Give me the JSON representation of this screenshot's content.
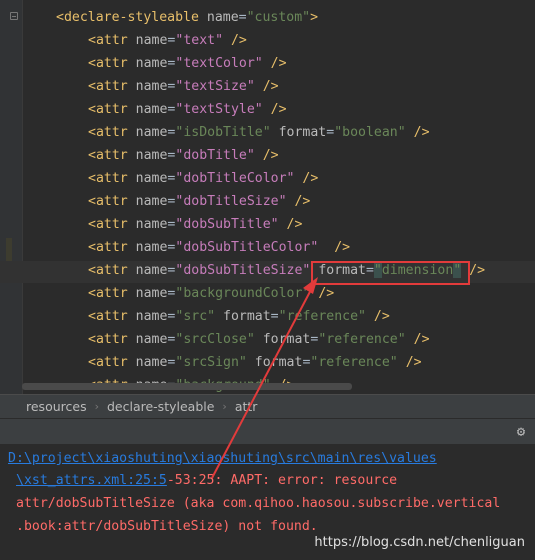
{
  "editor": {
    "lines": [
      {
        "indent": "",
        "tag": "<declare-styleable",
        "attr": "name",
        "value": "\"custom\"",
        "close": ">"
      },
      {
        "indent": "    ",
        "tag": "<attr",
        "attr": "name",
        "value": "\"text\"",
        "close": "/>"
      },
      {
        "indent": "    ",
        "tag": "<attr",
        "attr": "name",
        "value": "\"textColor\"",
        "close": "/>"
      },
      {
        "indent": "    ",
        "tag": "<attr",
        "attr": "name",
        "value": "\"textSize\"",
        "close": "/>"
      },
      {
        "indent": "    ",
        "tag": "<attr",
        "attr": "name",
        "value": "\"textStyle\"",
        "close": "/>"
      },
      {
        "indent": "    ",
        "tag": "<attr",
        "attr": "name",
        "value": "\"isDobTitle\"",
        "format": "\"boolean\"",
        "close": "/>"
      },
      {
        "indent": "    ",
        "tag": "<attr",
        "attr": "name",
        "value": "\"dobTitle\"",
        "close": "/>"
      },
      {
        "indent": "    ",
        "tag": "<attr",
        "attr": "name",
        "value": "\"dobTitleColor\"",
        "close": "/>"
      },
      {
        "indent": "    ",
        "tag": "<attr",
        "attr": "name",
        "value": "\"dobTitleSize\"",
        "close": "/>"
      },
      {
        "indent": "    ",
        "tag": "<attr",
        "attr": "name",
        "value": "\"dobSubTitle\"",
        "close": "/>"
      },
      {
        "indent": "    ",
        "tag": "<attr",
        "attr": "name",
        "value": "\"dobSubTitleColor\"",
        "close": " />"
      },
      {
        "indent": "    ",
        "tag": "<attr",
        "attr": "name",
        "value": "\"dobSubTitleSize\"",
        "format": "dimension",
        "close": "/>"
      },
      {
        "indent": "    ",
        "tag": "<attr",
        "attr": "name",
        "value": "\"backgroundColor\"",
        "close": "/>"
      },
      {
        "indent": "    ",
        "tag": "<attr",
        "attr": "name",
        "value": "\"src\"",
        "format": "\"reference\"",
        "close": "/>"
      },
      {
        "indent": "    ",
        "tag": "<attr",
        "attr": "name",
        "value": "\"srcClose\"",
        "format": "\"reference\"",
        "close": "/>"
      },
      {
        "indent": "    ",
        "tag": "<attr",
        "attr": "name",
        "value": "\"srcSign\"",
        "format": "\"reference\"",
        "close": "/>"
      },
      {
        "indent": "    ",
        "tag": "<attr",
        "attr": "name",
        "value": "\"background\"",
        "close": "/>"
      }
    ],
    "format_keyword": "format",
    "eq": "="
  },
  "breadcrumb": {
    "items": [
      "resources",
      "declare-styleable",
      "attr"
    ]
  },
  "console": {
    "path_link": "D:\\project\\xiaoshuting\\xiaoshuting\\src\\main\\res\\values",
    "file_link": "\\xst_attrs.xml:25:5",
    "error_rest": "-53:25: AAPT: error: resource",
    "error_line2": "attr/dobSubTitleSize (aka com.qihoo.haosou.subscribe.vertical",
    "error_line3": ".book:attr/dobSubTitleSize) not found."
  },
  "watermark": "https://blog.csdn.net/chenliguan",
  "icons": {
    "gear": "gear-icon",
    "fold": "fold-icon"
  },
  "colors": {
    "highlight_box": "#e23b3b",
    "arrow": "#e23b3b"
  }
}
